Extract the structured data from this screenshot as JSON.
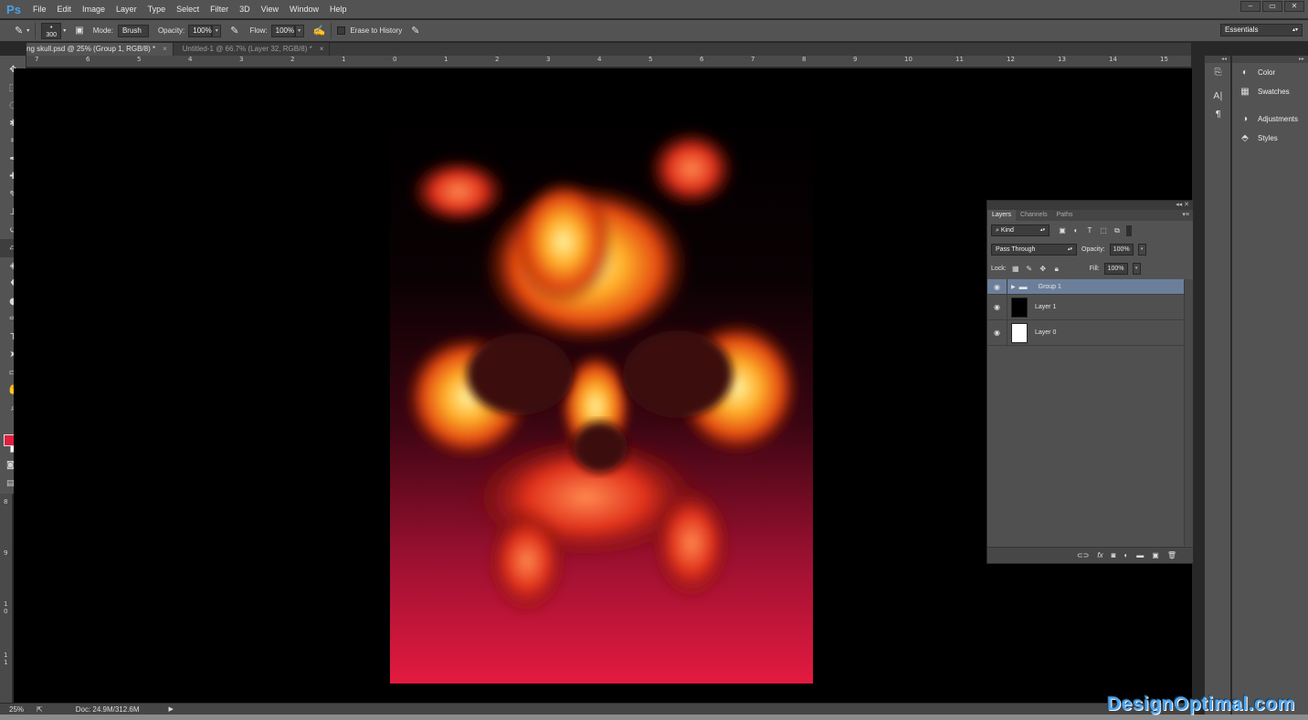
{
  "app": {
    "logo": "Ps"
  },
  "menu": [
    "File",
    "Edit",
    "Image",
    "Layer",
    "Type",
    "Select",
    "Filter",
    "3D",
    "View",
    "Window",
    "Help"
  ],
  "window_controls": [
    "‒",
    "▭",
    "✕"
  ],
  "options": {
    "brush_size": "300",
    "mode_label": "Mode:",
    "mode_value": "Brush",
    "opacity_label": "Opacity:",
    "opacity_value": "100%",
    "flow_label": "Flow:",
    "flow_value": "100%",
    "erase_history_label": "Erase to History",
    "workspace": "Essentials"
  },
  "tabs": [
    {
      "title": "ng skull.psd @ 25% (Group 1, RGB/8) *",
      "close": "×"
    },
    {
      "title": "Untitled-1 @ 66.7% (Layer 32, RGB/8) *",
      "close": "×"
    }
  ],
  "ruler": {
    "h": [
      "7",
      "6",
      "5",
      "4",
      "3",
      "2",
      "1",
      "0",
      "1",
      "2",
      "3",
      "4",
      "5",
      "6",
      "7",
      "8",
      "9",
      "10",
      "11",
      "12",
      "13",
      "14",
      "15"
    ],
    "v": [
      "8",
      "9",
      "1 0",
      "1 1"
    ]
  },
  "tools": [
    "move-tool",
    "marquee-tool",
    "lasso-tool",
    "magic-wand-tool",
    "crop-tool",
    "eyedropper-tool",
    "healing-brush-tool",
    "brush-tool",
    "clone-stamp-tool",
    "history-brush-tool",
    "eraser-tool",
    "paint-bucket-tool",
    "blur-tool",
    "dodge-tool",
    "pen-tool",
    "type-tool",
    "path-selection-tool",
    "shape-tool",
    "hand-tool",
    "zoom-tool"
  ],
  "colors": {
    "foreground": "#e0203f",
    "background": "#ffffff",
    "accent": "#4aa0e6"
  },
  "status": {
    "zoom": "25%",
    "doc": "Doc: 24.9M/312.6M"
  },
  "dock": {
    "items": [
      {
        "label": "Color",
        "icon": "color-icon"
      },
      {
        "label": "Swatches",
        "icon": "swatches-icon"
      },
      {
        "label": "Adjustments",
        "icon": "adjustments-icon"
      },
      {
        "label": "Styles",
        "icon": "styles-icon"
      }
    ]
  },
  "layers_panel": {
    "tabs": [
      "Layers",
      "Channels",
      "Paths"
    ],
    "filter": "Kind",
    "blend_mode": "Pass Through",
    "opacity_label": "Opacity:",
    "opacity_value": "100%",
    "lock_label": "Lock:",
    "fill_label": "Fill:",
    "fill_value": "100%",
    "layers": [
      {
        "name": "Group 1",
        "type": "group",
        "thumb": ""
      },
      {
        "name": "Layer 1",
        "type": "layer",
        "thumb": "#000000"
      },
      {
        "name": "Layer 0",
        "type": "layer",
        "thumb": "#ffffff"
      }
    ]
  },
  "watermark": "DesignOptimal.com"
}
